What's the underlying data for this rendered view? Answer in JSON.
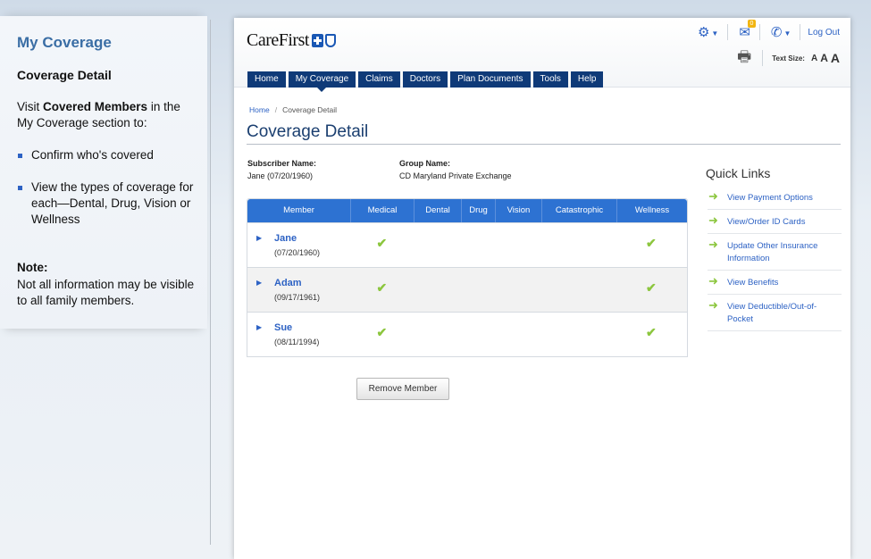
{
  "left_panel": {
    "title": "My Coverage",
    "subtitle": "Coverage Detail",
    "intro_pre": "Visit ",
    "intro_bold": "Covered Members",
    "intro_post": " in the My Coverage section to:",
    "bullets": [
      "Confirm who's covered",
      "View the types of coverage for each—Dental, Drug, Vision or Wellness"
    ],
    "note_heading": "Note:",
    "note_text": "Not all information may be visible to all family members."
  },
  "header": {
    "brand": "CareFirst",
    "mail_badge": "0",
    "logout": "Log Out",
    "text_size_label": "Text Size:",
    "text_sizes": [
      "A",
      "A",
      "A"
    ],
    "icons": [
      "gear-icon",
      "mail-icon",
      "phone-icon",
      "print-icon"
    ]
  },
  "nav": {
    "tabs": [
      "Home",
      "My Coverage",
      "Claims",
      "Doctors",
      "Plan Documents",
      "Tools",
      "Help"
    ],
    "active": "My Coverage"
  },
  "breadcrumb": {
    "home": "Home",
    "separator": "/",
    "current": "Coverage Detail"
  },
  "page_title": "Coverage Detail",
  "subscriber": {
    "label": "Subscriber Name:",
    "value": "Jane (07/20/1960)"
  },
  "group": {
    "label": "Group Name:",
    "value": "CD Maryland Private Exchange"
  },
  "table": {
    "columns": [
      "Member",
      "Medical",
      "Dental",
      "Drug",
      "Vision",
      "Catastrophic",
      "Wellness"
    ],
    "rows": [
      {
        "name": "Jane",
        "dob": "(07/20/1960)",
        "medical": true,
        "dental": false,
        "drug": false,
        "vision": false,
        "catastrophic": false,
        "wellness": true
      },
      {
        "name": "Adam",
        "dob": "(09/17/1961)",
        "medical": true,
        "dental": false,
        "drug": false,
        "vision": false,
        "catastrophic": false,
        "wellness": true
      },
      {
        "name": "Sue",
        "dob": "(08/11/1994)",
        "medical": true,
        "dental": false,
        "drug": false,
        "vision": false,
        "catastrophic": false,
        "wellness": true
      }
    ],
    "check_glyph": "✔",
    "expand_glyph": "▶"
  },
  "remove_button": "Remove Member",
  "quick_links": {
    "title": "Quick Links",
    "items": [
      "View Payment Options",
      "View/Order ID Cards",
      "Update Other Insurance Information",
      "View Benefits",
      "View Deductible/Out-of-Pocket"
    ]
  },
  "colors": {
    "accent": "#2d62c4",
    "nav_bg": "#0f3a78",
    "table_header": "#2d72d2",
    "check": "#8cc63e"
  }
}
